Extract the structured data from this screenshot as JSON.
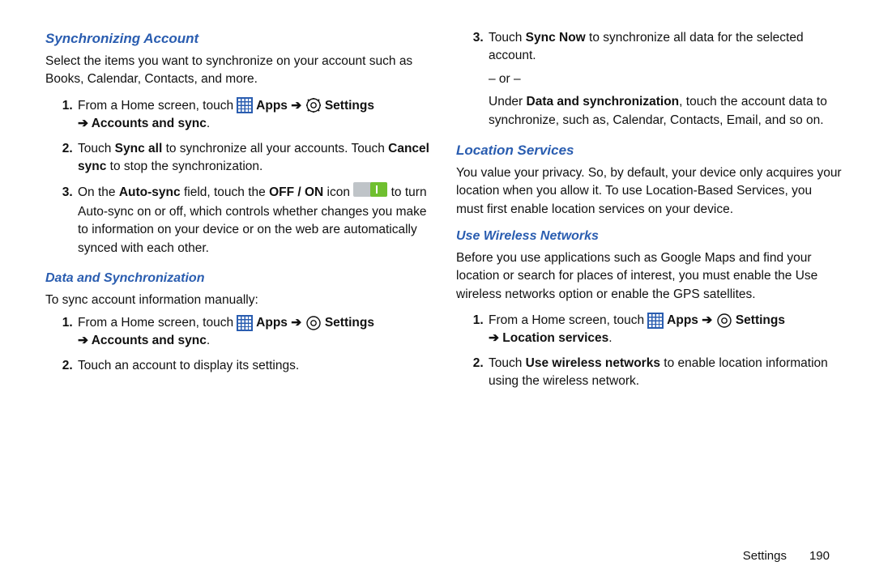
{
  "left": {
    "heading1": "Synchronizing Account",
    "intro1": "Select the items you want to synchronize on your account such as Books, Calendar, Contacts, and more.",
    "step1_a": "From a Home screen, touch ",
    "apps_label": " Apps ",
    "arrow": "➔",
    "settings_label": " Settings ",
    "step1_b": " Accounts and sync",
    "step1_c": ".",
    "step2_a": "Touch ",
    "sync_all": "Sync all",
    "step2_b": " to synchronize all your accounts. Touch ",
    "cancel_sync": "Cancel sync",
    "step2_c": " to stop the synchronization.",
    "step3_a": "On the ",
    "auto_sync": "Auto-sync",
    "step3_b": " field, touch the ",
    "off_on": "OFF / ON",
    "step3_c": " icon ",
    "step3_d": " to turn Auto-sync on or off, which controls whether changes you make to information on your device or on the web are automatically synced with each other.",
    "heading2": "Data and Synchronization",
    "intro2": "To sync account information manually:",
    "d_step1_a": "From a Home screen, touch ",
    "d_step1_b": " Accounts and sync",
    "d_step1_c": ".",
    "d_step2": "Touch an account to display its settings."
  },
  "right": {
    "r3_a": "Touch ",
    "sync_now": "Sync Now",
    "r3_b": " to synchronize all data for the selected account.",
    "or": "– or –",
    "r3_c_a": "Under ",
    "data_sync": "Data and synchronization",
    "r3_c_b": ", touch the account data to synchronize, such as, Calendar, Contacts, Email, and so on.",
    "heading3": "Location Services",
    "intro3": "You value your privacy. So, by default, your device only acquires your location when you allow it. To use Location-Based Services, you must first enable location services on your device.",
    "heading4": "Use Wireless Networks",
    "intro4": "Before you use applications such as Google Maps and find your location or search for places of interest, you must enable the Use wireless networks option or enable the GPS satellites.",
    "l_step1_a": "From a Home screen, touch ",
    "l_step1_b": " Location services",
    "l_step1_c": ".",
    "l_step2_a": "Touch ",
    "use_wireless": "Use wireless networks",
    "l_step2_b": " to enable location information using the wireless network."
  },
  "footer": {
    "section": "Settings",
    "page": "190"
  }
}
